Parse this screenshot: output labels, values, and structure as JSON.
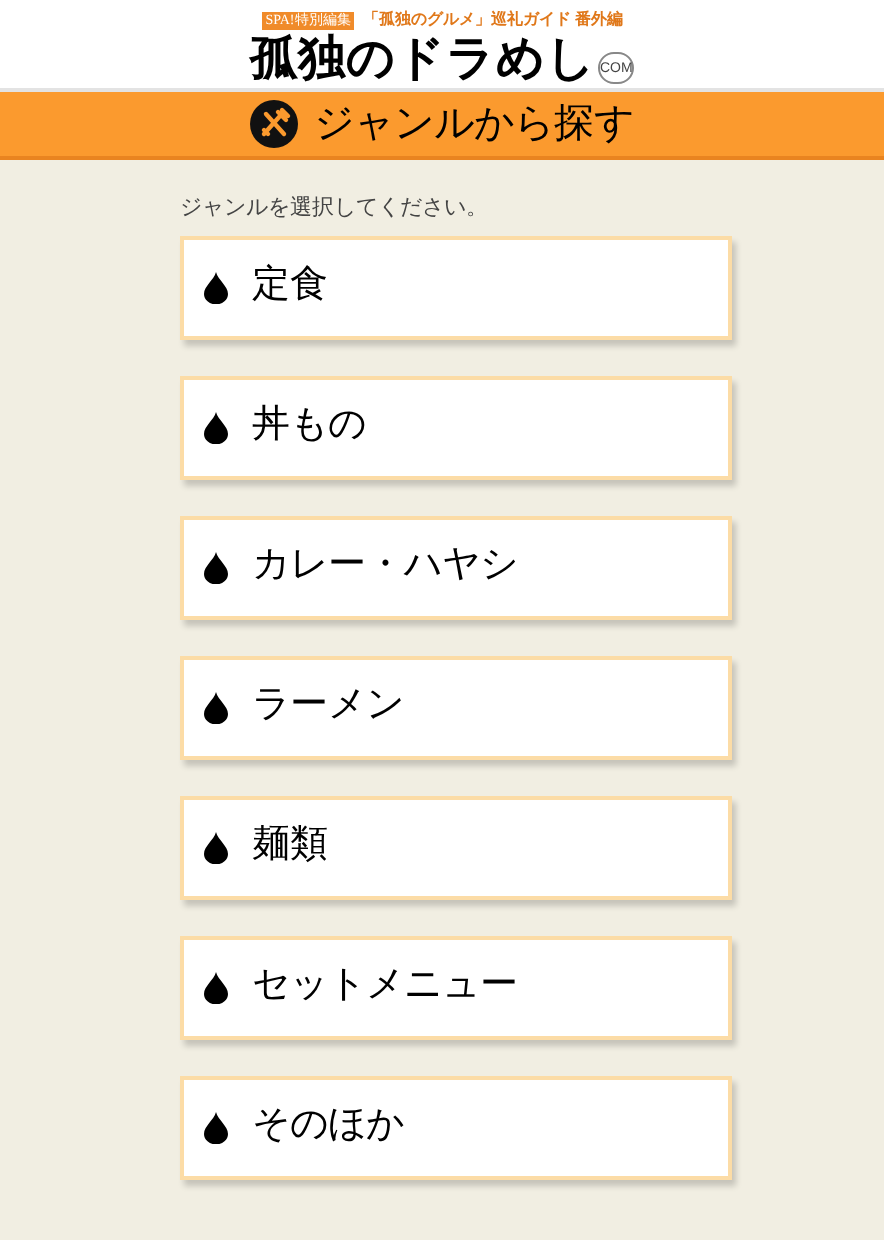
{
  "header": {
    "badge": "SPA!特別編集",
    "tagline": "「孤独のグルメ」巡礼ガイド 番外編",
    "logo": "孤独のドラめし",
    "logo_suffix": "COM"
  },
  "section_title": "ジャンルから探す",
  "instruction": "ジャンルを選択してください。",
  "genres": [
    {
      "label": "定食"
    },
    {
      "label": "丼もの"
    },
    {
      "label": "カレー・ハヤシ"
    },
    {
      "label": "ラーメン"
    },
    {
      "label": "麺類"
    },
    {
      "label": "セットメニュー"
    },
    {
      "label": "そのほか"
    }
  ]
}
